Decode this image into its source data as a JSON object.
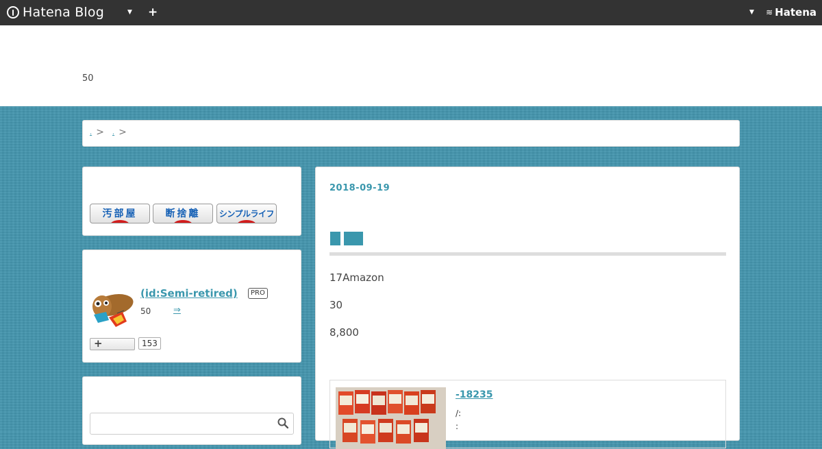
{
  "global_header": {
    "logo_text": "Hatena Blog",
    "menu_icon": "chevron-down-icon",
    "plus_label": "+",
    "account_icon": "chevron-down-icon",
    "hatena_brand": "Hatena"
  },
  "blog_header": {
    "description": "50"
  },
  "breadcrumb": {
    "items": [
      ".",
      "."
    ],
    "separator": ">"
  },
  "sidebar": {
    "badges": [
      "汚部屋",
      "断捨離",
      "シンプルライフ"
    ],
    "profile": {
      "name": " (id:Semi-retired)",
      "pro_label": "PRO",
      "description": "50",
      "more_link": "⇒",
      "follow_count": "153"
    },
    "search": {
      "placeholder": ""
    }
  },
  "article": {
    "date": "2018-09-19",
    "paragraphs": [
      "17Amazon",
      "30",
      "8,800"
    ],
    "embed": {
      "title": "-18235",
      "meta1": "/:",
      "meta2": ":"
    }
  },
  "colors": {
    "accent": "#3a97ad",
    "page_background": "#4596ad",
    "global_bar": "#333333",
    "badge_text": "#1560b5",
    "badge_dot": "#d21c1c"
  }
}
